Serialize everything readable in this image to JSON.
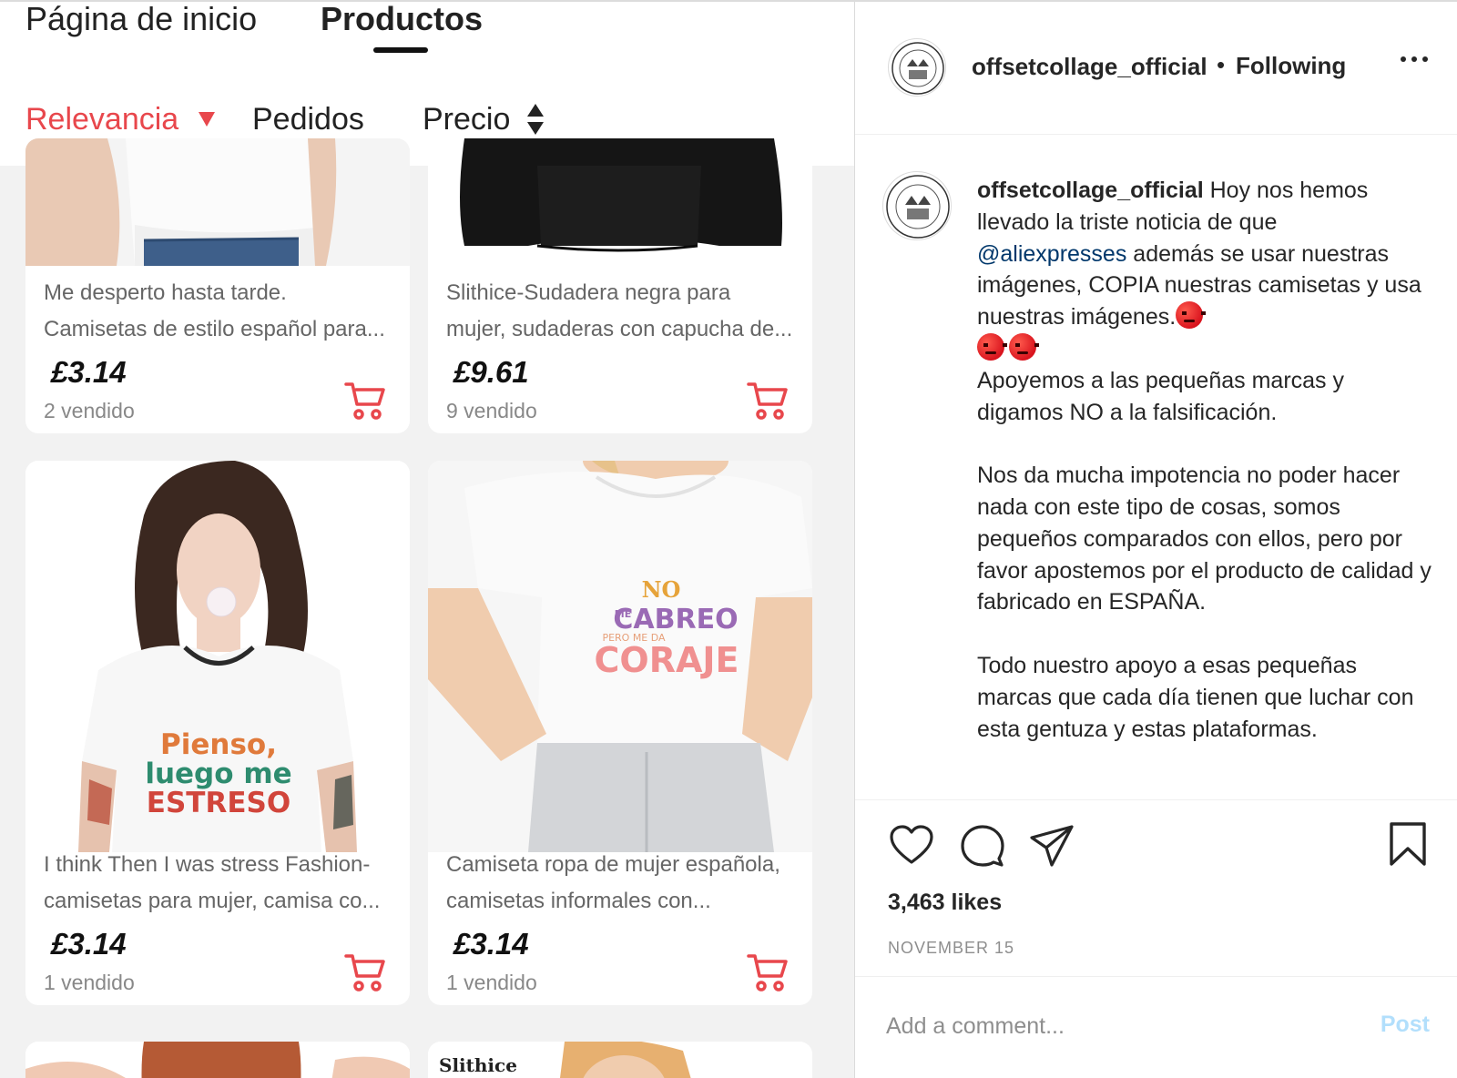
{
  "shop": {
    "tabs": [
      "Página de inicio",
      "Productos"
    ],
    "sort": {
      "relevance": "Relevancia",
      "orders": "Pedidos",
      "price": "Precio"
    },
    "products": [
      {
        "title1": "Me desperto hasta tarde.",
        "title2": "Camisetas de estilo español para...",
        "price": "£3.14",
        "sold": "2 vendido"
      },
      {
        "title1": "Slithice-Sudadera negra para",
        "title2": "mujer, sudaderas con capucha de...",
        "price": "£9.61",
        "sold": "9 vendido"
      },
      {
        "title1": "I think Then I was stress Fashion-",
        "title2": "camisetas para mujer, camisa co...",
        "price": "£3.14",
        "sold": "1 vendido",
        "shirt_text": [
          "Pienso,",
          "luego me",
          "ESTRESO"
        ]
      },
      {
        "title1": "Camiseta ropa de mujer española,",
        "title2": "camisetas informales con...",
        "price": "£3.14",
        "sold": "1 vendido",
        "shirt_text": [
          "NO",
          "ME",
          "CABREO",
          "PERO ME DA",
          "CORAJE"
        ]
      }
    ],
    "brand_label": "Slithice",
    "accent_color": "#e8474c"
  },
  "post": {
    "username": "offsetcollage_official",
    "following": "Following",
    "dot": "•",
    "caption": {
      "p1_a": " Hoy nos hemos llevado la triste noticia de que ",
      "mention": "@aliexpresses",
      "p1_b": " además se usar nuestras imágenes, COPIA nuestras camisetas y usa nuestras imágenes.",
      "p2": "Apoyemos a las pequeñas marcas y digamos NO a la falsificación.",
      "p3": "Nos da mucha impotencia no poder hacer nada con este tipo de cosas, somos pequeños comparados con ellos, pero por favor apostemos por el producto de calidad y fabricado en ESPAÑA.",
      "p4": "Todo nuestro apoyo a esas pequeñas marcas que cada día tienen que luchar con esta gentuza y estas plataformas."
    },
    "likes": "3,463 likes",
    "date": "NOVEMBER 15",
    "comment_placeholder": "Add a comment...",
    "post_label": "Post"
  }
}
